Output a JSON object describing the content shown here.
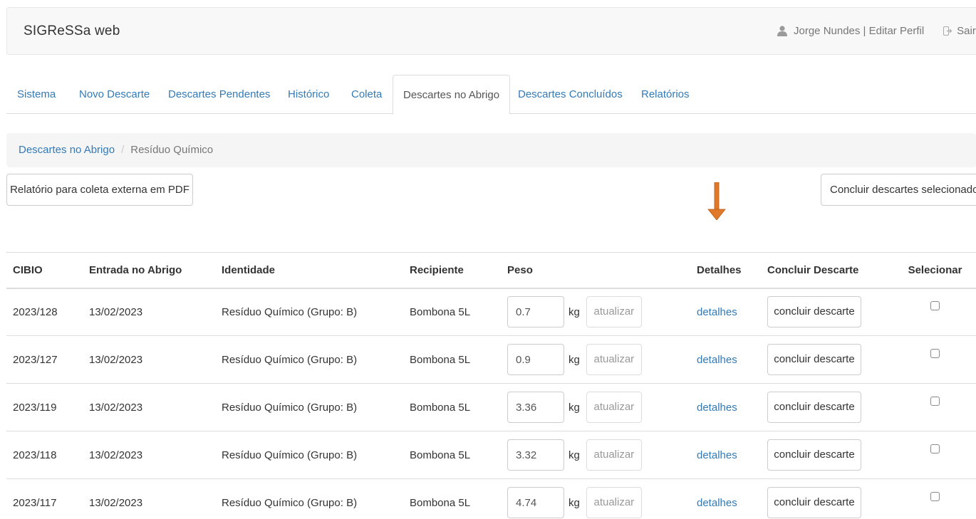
{
  "app": {
    "brand": "SIGReSSa web",
    "user_label": "Jorge Nundes | Editar Perfil",
    "logout_label": "Sair",
    "user_icon": "user-icon",
    "logout_icon": "logout-icon"
  },
  "tabs": [
    {
      "label": "Sistema"
    },
    {
      "label": "Novo Descarte"
    },
    {
      "label": "Descartes Pendentes"
    },
    {
      "label": "Histórico"
    },
    {
      "label": "Coleta"
    },
    {
      "label": "Descartes no Abrigo",
      "active": true
    },
    {
      "label": "Descartes Concluídos"
    },
    {
      "label": "Relatórios"
    }
  ],
  "breadcrumb": {
    "parent": "Descartes no Abrigo",
    "separator": "/",
    "current": "Resíduo Químico"
  },
  "actions": {
    "pdf_button": "Relatório para coleta externa em PDF",
    "conclude_selected_button": "Concluir descartes selecionados"
  },
  "colors": {
    "link": "#337ab7",
    "arrow": "#e07a2a"
  },
  "table": {
    "headers": [
      "CIBIO",
      "Entrada no Abrigo",
      "Identidade",
      "Recipiente",
      "Peso",
      "Detalhes",
      "Concluir Descarte",
      "Selecionar"
    ],
    "unit": "kg",
    "update_label": "atualizar",
    "details_label": "detalhes",
    "conclude_label": "concluir descarte",
    "rows": [
      {
        "cibio": "2023/128",
        "entrada": "13/02/2023",
        "identidade": "Resíduo Químico (Grupo: B)",
        "recipiente": "Bombona 5L",
        "peso": "0.7",
        "selected": false
      },
      {
        "cibio": "2023/127",
        "entrada": "13/02/2023",
        "identidade": "Resíduo Químico (Grupo: B)",
        "recipiente": "Bombona 5L",
        "peso": "0.9",
        "selected": false
      },
      {
        "cibio": "2023/119",
        "entrada": "13/02/2023",
        "identidade": "Resíduo Químico (Grupo: B)",
        "recipiente": "Bombona 5L",
        "peso": "3.36",
        "selected": false
      },
      {
        "cibio": "2023/118",
        "entrada": "13/02/2023",
        "identidade": "Resíduo Químico (Grupo: B)",
        "recipiente": "Bombona 5L",
        "peso": "3.32",
        "selected": false
      },
      {
        "cibio": "2023/117",
        "entrada": "13/02/2023",
        "identidade": "Resíduo Químico (Grupo: B)",
        "recipiente": "Bombona 5L",
        "peso": "4.74",
        "selected": false
      }
    ]
  }
}
